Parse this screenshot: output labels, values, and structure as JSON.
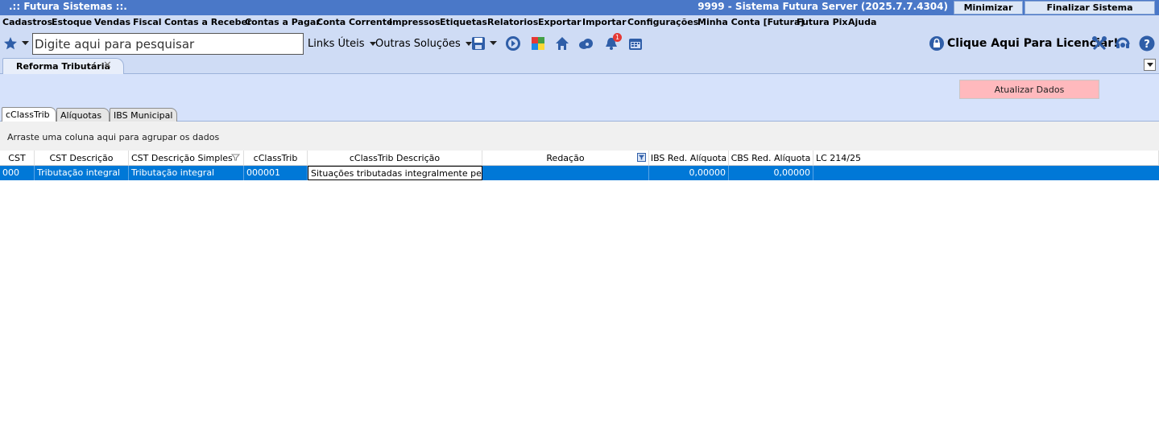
{
  "window": {
    "app_title": ".:: Futura Sistemas ::.",
    "server_title": "9999 - Sistema Futura Server (2025.7.7.4304)",
    "minimize_label": "Minimizar",
    "close_label": "Finalizar Sistema"
  },
  "menu": [
    "Cadastros",
    "Estoque",
    "Vendas",
    "Fiscal",
    "Contas a Receber",
    "Contas a Pagar",
    "Conta Corrente",
    "Impressos",
    "Etiquetas",
    "Relatorios",
    "Exportar",
    "Importar",
    "Configurações",
    "Minha Conta [Futura]",
    "Futura Pix",
    "Ajuda"
  ],
  "toolbar": {
    "search_placeholder": "Digite aqui para pesquisar",
    "links_label": "Links Úteis",
    "solutions_label": "Outras Soluções",
    "notification_count": "1",
    "license_label": "Clique Aqui Para Licenciar!"
  },
  "doc_tab": {
    "label": "Reforma Tributária",
    "close": "✕"
  },
  "panel": {
    "refresh_label": "Atualizar Dados"
  },
  "subtabs": [
    "cClassTrib",
    "Alíquotas",
    "IBS Municipal"
  ],
  "group_hint": "Arraste uma coluna aqui para agrupar os dados",
  "grid": {
    "columns": [
      "CST",
      "CST Descrição",
      "CST Descrição Simples",
      "cClassTrib",
      "cClassTrib Descrição",
      "Redação",
      "IBS Red. Alíquota",
      "CBS Red. Alíquota",
      "LC 214/25"
    ],
    "rows": [
      [
        "000",
        "Tributação integral",
        "Tributação integral",
        "000001",
        "Situações tributadas integralmente pelo I",
        "",
        "0,00000",
        "0,00000",
        ""
      ]
    ]
  },
  "colors": {
    "titlebar": "#4a78c8",
    "menubar": "#cfdcf5",
    "selection": "#0078d7",
    "refresh_button": "#ffb9bd"
  }
}
